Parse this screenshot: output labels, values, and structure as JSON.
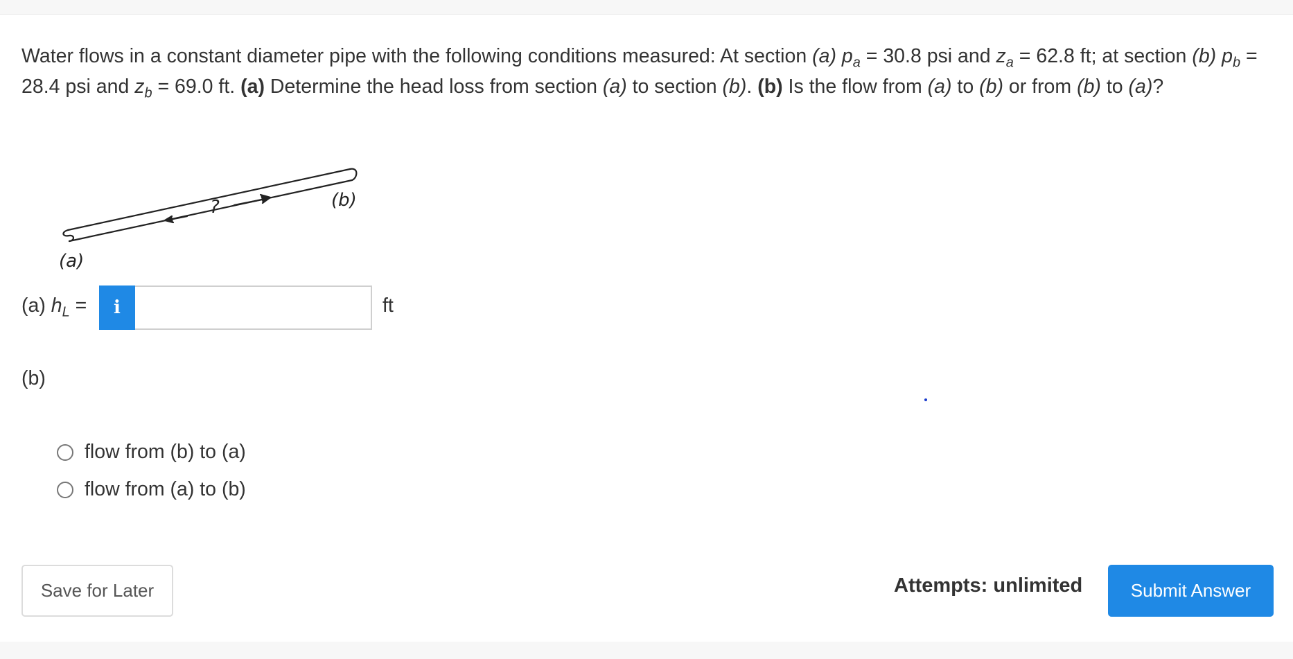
{
  "question": {
    "intro": "Water flows in a constant diameter pipe with the following conditions measured: At section ",
    "sec_a": "(a)",
    "pa_sym": "p",
    "pa_sub": "a",
    "pa_val": " = 30.8 psi and ",
    "za_sym": "z",
    "za_sub": "a",
    "za_val": " = 62.8 ft; at section ",
    "sec_b": "(b)",
    "pb_sym": "p",
    "pb_sub": "b",
    "pb_val": " = 28.4 psi and ",
    "zb_sym": "z",
    "zb_sub": "b",
    "zb_val": " = 69.0 ft. ",
    "part_a_tag": "(a)",
    "part_a_text": " Determine the head loss from section ",
    "part_a_from": "(a)",
    "part_a_mid": " to section ",
    "part_a_to": "(b)",
    "part_a_end": ". ",
    "part_b_tag": "(b)",
    "part_b_text": " Is the flow from ",
    "part_b_1": "(a)",
    "part_b_mid1": " to ",
    "part_b_2": "(b)",
    "part_b_mid2": " or from ",
    "part_b_3": "(b)",
    "part_b_mid3": " to ",
    "part_b_4": "(a)",
    "part_b_end": "?"
  },
  "figure": {
    "label_a": "(a)",
    "label_b": "(b)",
    "question_mark": "?"
  },
  "part_a": {
    "label_prefix": "(a) ",
    "h_sym": "h",
    "h_sub": "L",
    "equals": " =",
    "info_icon_glyph": "i",
    "input_value": "",
    "unit": "ft"
  },
  "part_b": {
    "label": "(b)",
    "options": [
      "flow from (b) to (a)",
      "flow from (a) to (b)"
    ]
  },
  "footer": {
    "save_label": "Save for Later",
    "attempts_text": "Attempts: unlimited",
    "submit_label": "Submit Answer"
  },
  "colors": {
    "accent": "#1f89e5",
    "text": "#333333",
    "border": "#dcdcdc"
  }
}
